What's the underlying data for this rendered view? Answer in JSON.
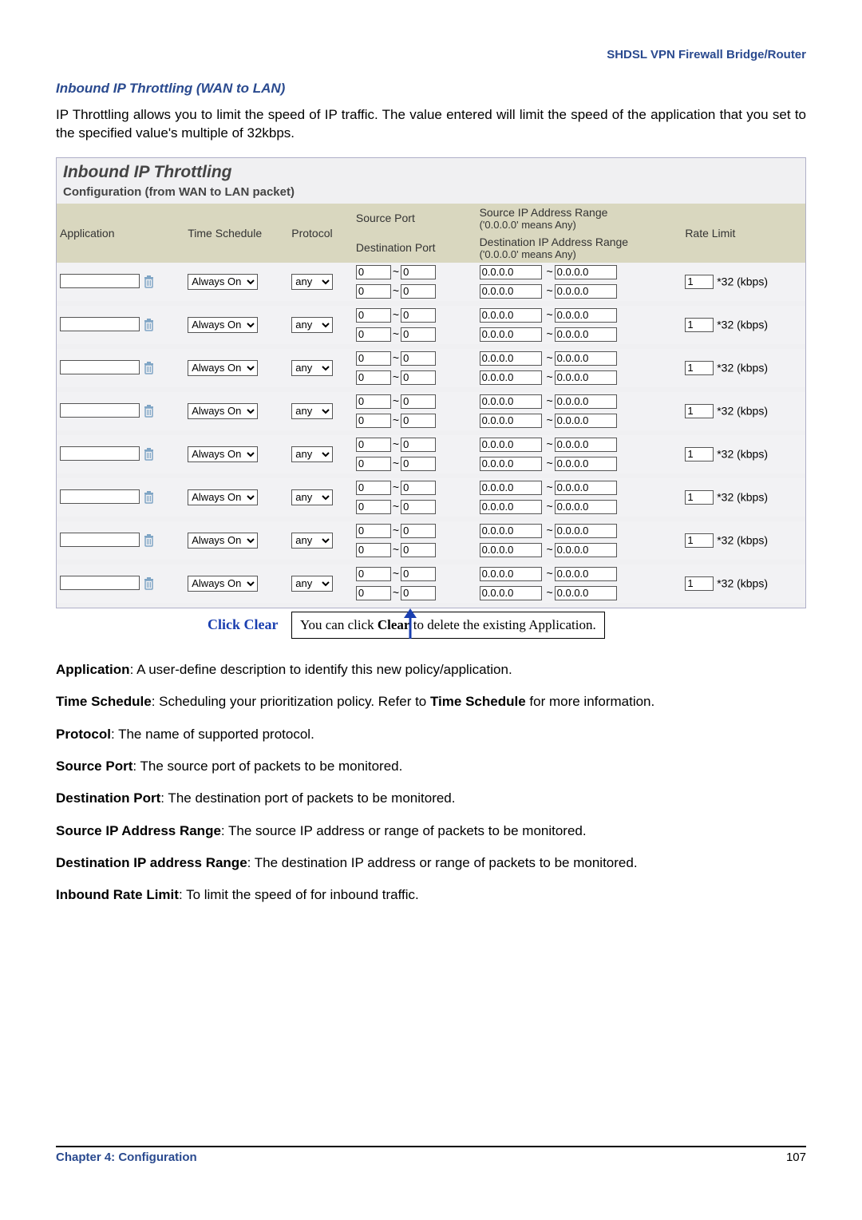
{
  "header": {
    "product": "SHDSL VPN Firewall Bridge/Router"
  },
  "section": {
    "title": "Inbound IP Throttling (WAN to LAN)",
    "intro": "IP Throttling allows you to limit the speed of IP traffic. The value entered will limit the speed of the application that you set to the specified value's multiple of 32kbps."
  },
  "panel": {
    "title": "Inbound IP Throttling",
    "subtitle": "Configuration (from WAN to LAN packet)",
    "headers": {
      "application": "Application",
      "time_schedule": "Time Schedule",
      "protocol": "Protocol",
      "source_port": "Source Port",
      "destination_port": "Destination Port",
      "src_ip": "Source IP Address Range",
      "src_ip_hint": "('0.0.0.0' means Any)",
      "dst_ip": "Destination IP Address Range",
      "dst_ip_hint": "('0.0.0.0' means Any)",
      "rate_limit": "Rate Limit"
    },
    "defaults": {
      "time_schedule_value": "Always On",
      "protocol_value": "any",
      "port_from": "0",
      "port_to": "0",
      "ip_from": "0.0.0.0",
      "ip_to": "0.0.0.0",
      "rate_value": "1",
      "rate_unit": "*32 (kbps)"
    },
    "row_count": 8
  },
  "callout": {
    "label": "Click Clear",
    "text_a": "You can click ",
    "text_b": "Clear",
    "text_c": " to delete the existing Application."
  },
  "definitions": [
    {
      "term": "Application",
      "text": ": A user-define description to identify this new policy/application."
    },
    {
      "term": "Time Schedule",
      "text": ": Scheduling your prioritization policy.    Refer to ",
      "term2": "Time Schedule",
      "text2": " for more information."
    },
    {
      "term": "Protocol",
      "text": ": The name of supported protocol."
    },
    {
      "term": "Source Port",
      "text": ": The source port of packets to be monitored."
    },
    {
      "term": "Destination Port",
      "text": ": The destination port of packets to be monitored."
    },
    {
      "term": "Source IP Address Range",
      "text": ": The source IP address or range of packets to be monitored."
    },
    {
      "term": "Destination IP address Range",
      "text": ": The destination IP address or range of packets to be monitored."
    },
    {
      "term": "Inbound Rate Limit",
      "text": ": To limit the speed of for inbound traffic."
    }
  ],
  "footer": {
    "chapter": "Chapter 4: Configuration",
    "page": "107"
  }
}
